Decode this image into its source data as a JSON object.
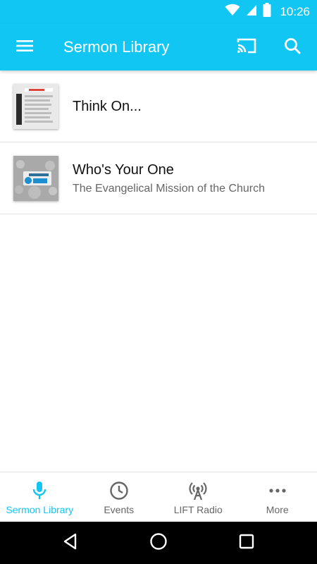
{
  "status_bar": {
    "time": "10:26",
    "icons": [
      "wifi-icon",
      "cell-signal-icon",
      "battery-icon"
    ]
  },
  "app_bar": {
    "title": "Sermon Library",
    "icons": [
      "menu-icon",
      "cast-icon",
      "search-icon"
    ]
  },
  "sermons": [
    {
      "title": "Think On...",
      "subtitle": ""
    },
    {
      "title": "Who's Your One",
      "subtitle": "The Evangelical Mission of the Church"
    }
  ],
  "bottom_nav": {
    "items": [
      {
        "label": "Sermon Library",
        "icon": "microphone-icon",
        "active": true
      },
      {
        "label": "Events",
        "icon": "clock-icon",
        "active": false
      },
      {
        "label": "LIFT Radio",
        "icon": "radio-tower-icon",
        "active": false
      },
      {
        "label": "More",
        "icon": "more-dots-icon",
        "active": false
      }
    ]
  },
  "colors": {
    "primary": "#12c6f3",
    "text_primary": "#111111",
    "text_secondary": "#666666"
  },
  "system_nav": {
    "icons": [
      "back-icon",
      "home-icon",
      "recents-icon"
    ]
  }
}
